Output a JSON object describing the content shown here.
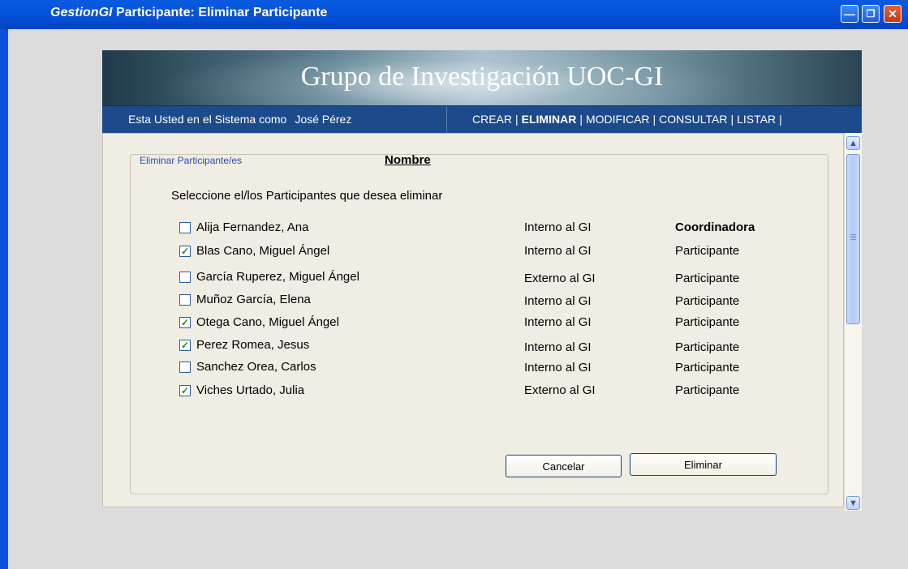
{
  "window": {
    "app_name": "GestionGI",
    "title": "Participante: Eliminar Participante",
    "controls": [
      "minimize",
      "maximize",
      "close"
    ]
  },
  "banner": {
    "title": "Grupo de Investigación UOC-GI"
  },
  "navbar": {
    "user_prefix": "Esta Usted en el Sistema como",
    "user_name": "José Pérez",
    "links": [
      "CREAR",
      "ELIMINAR",
      "MODIFICAR",
      "CONSULTAR",
      "LISTAR"
    ],
    "active": "ELIMINAR"
  },
  "form": {
    "legend": "Eliminar Participante/es",
    "column_header": "Nombre",
    "instruction": "Seleccione el/los Participantes que desea  eliminar",
    "participants": [
      {
        "name": "Alija Fernandez, Ana",
        "type": "Interno al GI",
        "role": "Coordinadora",
        "checked": false
      },
      {
        "name": "Blas Cano, Miguel Ángel",
        "type": "Interno al GI",
        "role": "Participante",
        "checked": true
      },
      {
        "name": "García Ruperez, Miguel Ángel",
        "type": "Externo al GI",
        "role": "Participante",
        "checked": false
      },
      {
        "name": "Muñoz García, Elena",
        "type": "Interno al GI",
        "role": "Participante",
        "checked": false
      },
      {
        "name": "Otega Cano, Miguel Ángel",
        "type": "Interno al GI",
        "role": "Participante",
        "checked": true
      },
      {
        "name": "Perez Romea, Jesus",
        "type": "Interno al GI",
        "role": "Participante",
        "checked": true
      },
      {
        "name": "Sanchez Orea, Carlos",
        "type": "Interno al GI",
        "role": "Participante",
        "checked": false
      },
      {
        "name": "Viches Urtado, Julia",
        "type": "Externo al GI",
        "role": "Participante",
        "checked": true
      }
    ],
    "cancel_label": "Cancelar",
    "delete_label": "Eliminar"
  },
  "colors": {
    "titlebar": "#0653d8",
    "navbar": "#1c4a8a",
    "panel_bg": "#f0ede4",
    "legend_text": "#2a4ea8",
    "check": "#1c8a2c"
  }
}
